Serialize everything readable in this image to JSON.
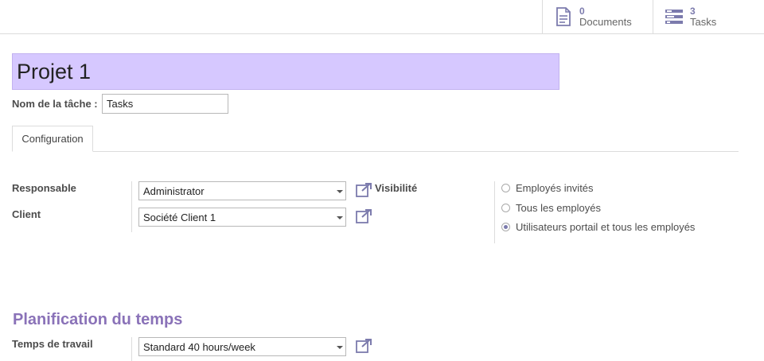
{
  "stat_buttons": {
    "documents": {
      "value": "0",
      "label": "Documents"
    },
    "tasks": {
      "value": "3",
      "label": "Tasks"
    }
  },
  "title": "Projet 1",
  "task_name": {
    "label": "Nom de la tâche :",
    "value": "Tasks"
  },
  "tabs": [
    {
      "label": "Configuration"
    }
  ],
  "fields": {
    "responsable": {
      "label": "Responsable",
      "value": "Administrator"
    },
    "client": {
      "label": "Client",
      "value": "Société Client 1"
    },
    "visibilite": {
      "label": "Visibilité",
      "options": [
        {
          "label": "Employés invités",
          "checked": false
        },
        {
          "label": "Tous les employés",
          "checked": false
        },
        {
          "label": "Utilisateurs portail et tous les employés",
          "checked": true
        }
      ]
    }
  },
  "planning": {
    "section_title": "Planification du temps",
    "working_time": {
      "label": "Temps de travail",
      "value": "Standard 40 hours/week"
    }
  },
  "colors": {
    "accent": "#7c7bad",
    "title_bg": "#d6c8ff",
    "section": "#8a72b8"
  }
}
